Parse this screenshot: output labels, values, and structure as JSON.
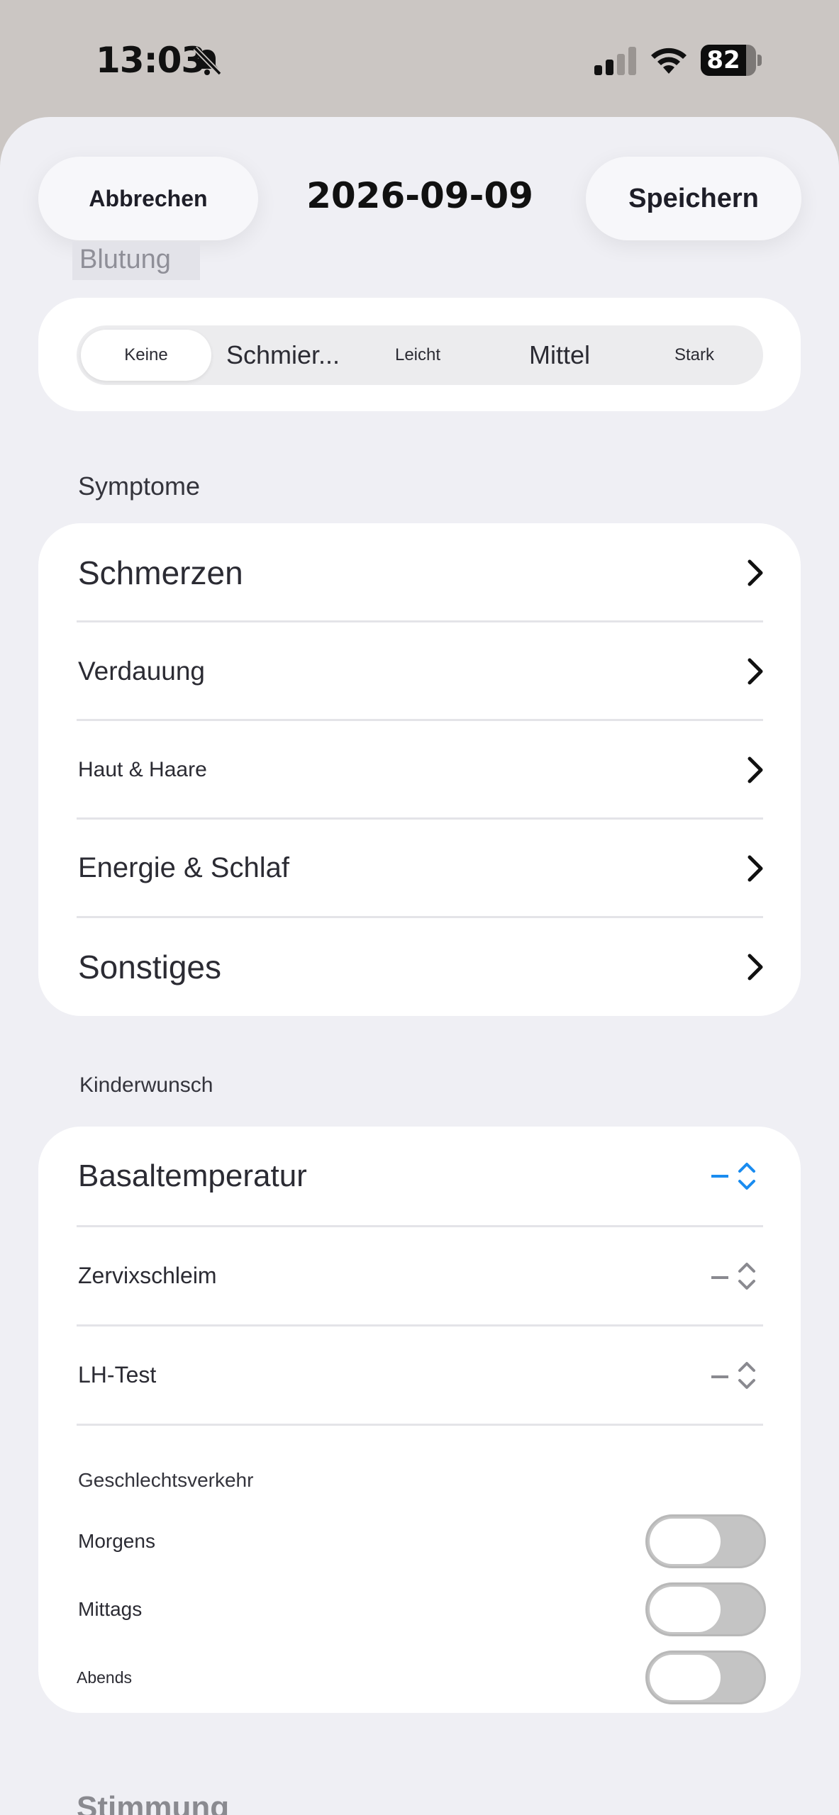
{
  "status_bar": {
    "time": "13:03",
    "battery": "82",
    "battery_level": 0.82
  },
  "header": {
    "cancel": "Abbrechen",
    "title": "2026-09-09",
    "save": "Speichern"
  },
  "bleeding": {
    "label": "Blutung",
    "options": [
      "Keine",
      "Schmier...",
      "Leicht",
      "Mittel",
      "Stark"
    ],
    "selected": "Keine"
  },
  "symptoms": {
    "label": "Symptome",
    "items": [
      "Schmerzen",
      "Verdauung",
      "Haut & Haare",
      "Energie & Schlaf",
      "Sonstiges"
    ]
  },
  "fertility": {
    "label": "Kinderwunsch",
    "pickers": [
      {
        "label": "Basaltemperatur",
        "value": "–"
      },
      {
        "label": "Zervixschleim",
        "value": "–"
      },
      {
        "label": "LH-Test",
        "value": "–"
      }
    ],
    "intercourse": {
      "label": "Geschlechtsverkehr",
      "toggles": [
        {
          "label": "Morgens",
          "on": false
        },
        {
          "label": "Mittags",
          "on": false
        },
        {
          "label": "Abends",
          "on": false
        }
      ]
    }
  },
  "mood": {
    "label": "Stimmung"
  },
  "colors": {
    "accent": "#1a8cf0",
    "background": "#efeff4",
    "toggle_off": "#c4c4c4"
  }
}
